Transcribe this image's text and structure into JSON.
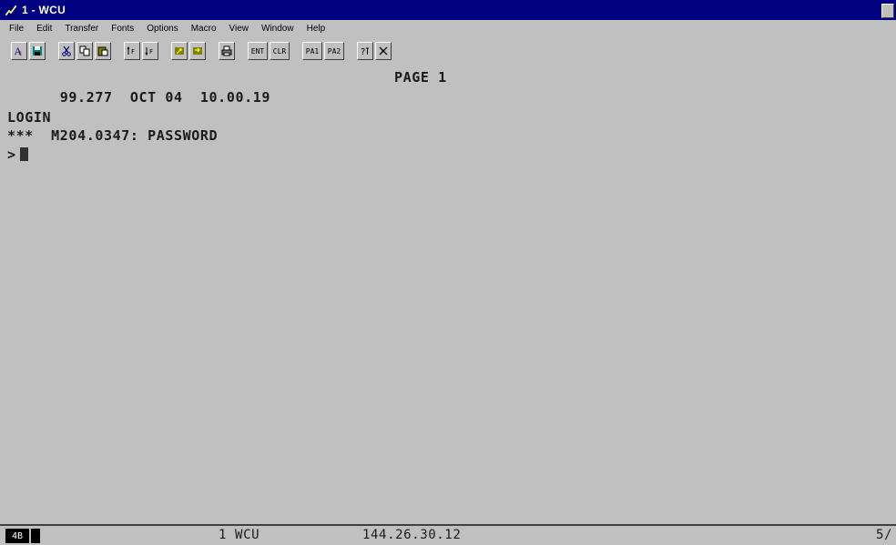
{
  "window": {
    "title": "1 - WCU"
  },
  "menu": {
    "items": [
      "File",
      "Edit",
      "Transfer",
      "Fonts",
      "Options",
      "Macro",
      "View",
      "Window",
      "Help"
    ]
  },
  "toolbar": {
    "groups": [
      {
        "buttons": [
          {
            "icon": "font-icon"
          },
          {
            "icon": "save-icon"
          }
        ]
      },
      {
        "buttons": [
          {
            "icon": "cut-icon"
          },
          {
            "icon": "copy-icon"
          },
          {
            "icon": "paste-icon"
          }
        ]
      },
      {
        "buttons": [
          {
            "icon": "send-file-icon"
          },
          {
            "icon": "receive-file-icon"
          }
        ]
      },
      {
        "buttons": [
          {
            "icon": "macro-play-icon"
          },
          {
            "icon": "macro-record-icon"
          }
        ]
      },
      {
        "buttons": [
          {
            "icon": "print-icon"
          }
        ]
      },
      {
        "buttons": [
          {
            "label": "ENT"
          },
          {
            "label": "CLR"
          }
        ]
      },
      {
        "buttons": [
          {
            "label": "PA1"
          },
          {
            "label": "PA2"
          }
        ]
      },
      {
        "buttons": [
          {
            "icon": "help-icon"
          },
          {
            "icon": "close-session-icon"
          }
        ]
      }
    ]
  },
  "terminal": {
    "header_date": "99.277",
    "header_month_day": "OCT 04",
    "header_time": "10.00.19",
    "header_page": "PAGE 1",
    "line_login": "LOGIN",
    "line_message_prefix": "***",
    "line_message": "M204.0347: PASSWORD",
    "prompt": ">"
  },
  "statusbar": {
    "indicator": "4B",
    "session": "1 WCU",
    "ip_address": "144.26.30.12",
    "right_text": "5/"
  }
}
